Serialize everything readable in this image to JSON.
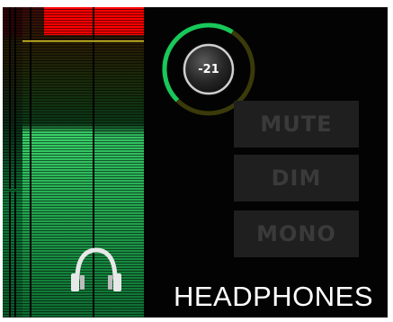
{
  "volume": {
    "value_label": "-21",
    "value_db": -21,
    "level_fraction": 0.62
  },
  "buttons": {
    "mute_label": "MUTE",
    "dim_label": "DIM",
    "mono_label": "MONO"
  },
  "output": {
    "title": "HEADPHONES",
    "icon": "headphones-icon"
  },
  "meter": {
    "channels": 2,
    "level_fraction": 0.6,
    "clip_indicator": "on",
    "colors": {
      "clip": "#ff0000",
      "peak_hold": "#e7d62a",
      "level_high": "#39d36a",
      "level_low": "#0f7a3a",
      "knob_arc_active": "#18c85a",
      "knob_arc_inactive": "#3a3a0a"
    }
  }
}
